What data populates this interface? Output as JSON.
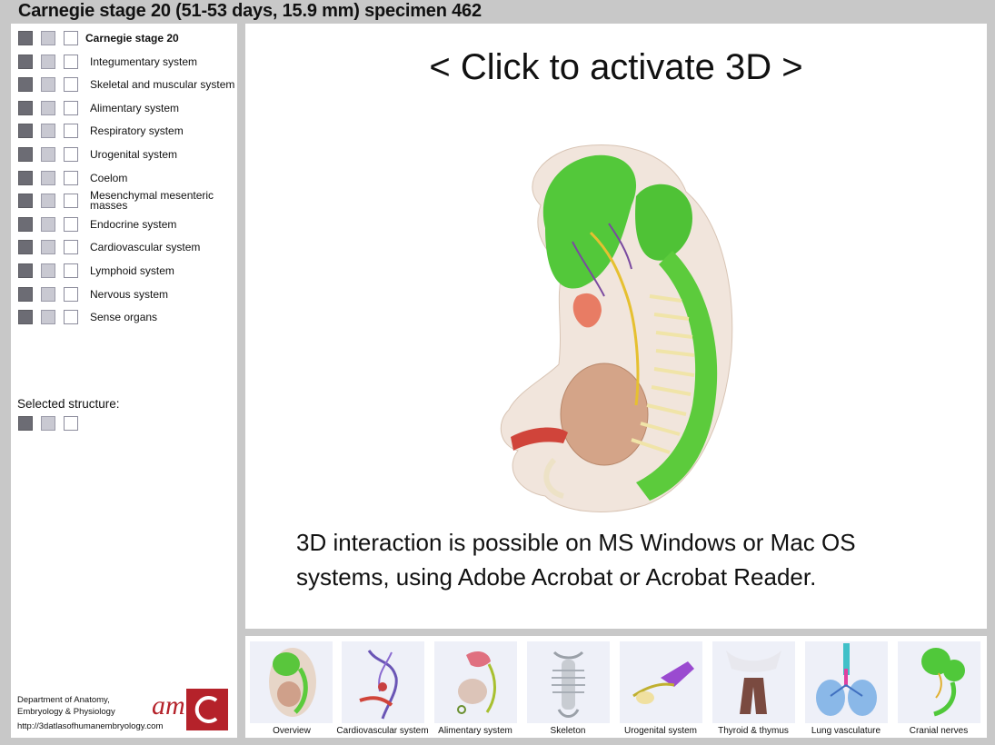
{
  "title": "Carnegie stage 20 (51-53 days, 15.9 mm) specimen 462",
  "tree": {
    "root": "Carnegie stage 20",
    "items": [
      "Integumentary system",
      "Skeletal and muscular system",
      "Alimentary system",
      "Respiratory system",
      "Urogenital system",
      "Coelom",
      "Mesenchymal mesenteric masses",
      "Endocrine system",
      "Cardiovascular system",
      "Lymphoid system",
      "Nervous system",
      "Sense organs"
    ]
  },
  "selected_label": "Selected structure:",
  "footer": {
    "dept_line1": "Department of Anatomy,",
    "dept_line2": "Embryology & Physiology",
    "url": "http://3datlasofhumanembryology.com",
    "logo_text": "am"
  },
  "viewer": {
    "activate": "< Click to activate 3D >",
    "info_line1": "3D interaction is possible on MS Windows or Mac OS",
    "info_line2": "systems, using Adobe Acrobat or Acrobat Reader."
  },
  "thumbnails": [
    "Overview",
    "Cardiovascular system",
    "Alimentary system",
    "Skeleton",
    "Urogenital system",
    "Thyroid & thymus",
    "Lung vasculature",
    "Cranial nerves"
  ],
  "colors": {
    "background": "#c8c8c8",
    "swatch_dark": "#6c6c74",
    "swatch_mid": "#c9c9d2",
    "logo_red": "#b5222a"
  }
}
